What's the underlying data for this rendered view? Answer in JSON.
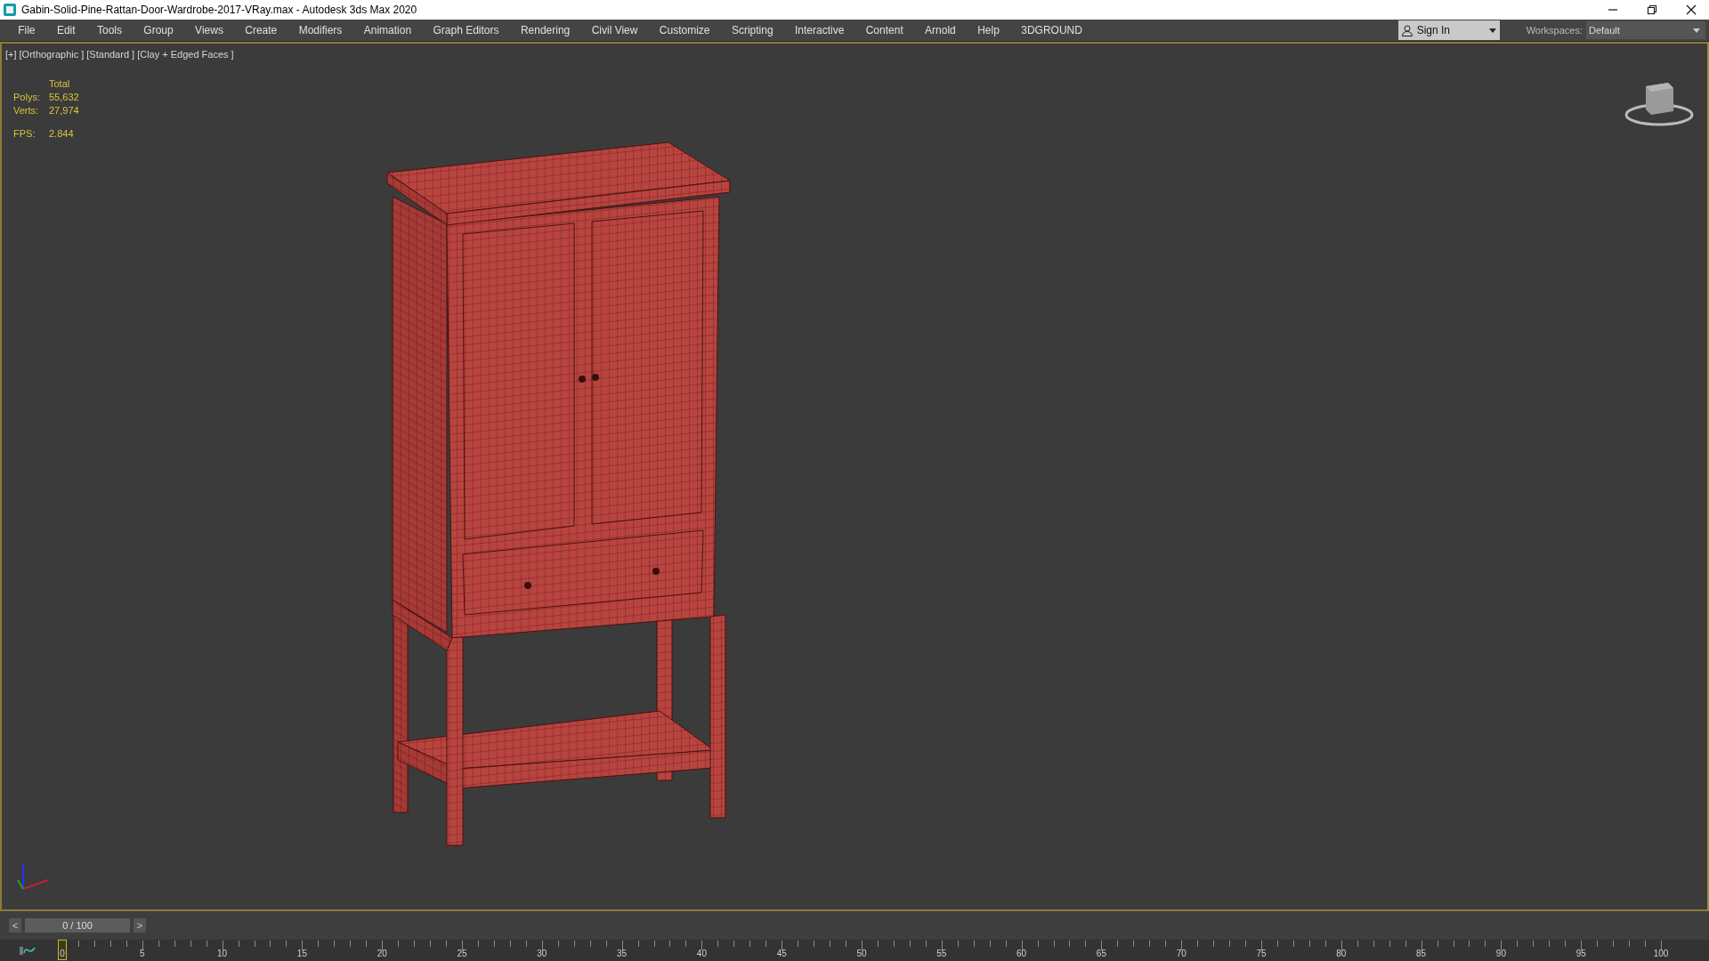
{
  "window": {
    "title": "Gabin-Solid-Pine-Rattan-Door-Wardrobe-2017-VRay.max - Autodesk 3ds Max 2020"
  },
  "menu_bar": {
    "items": [
      "File",
      "Edit",
      "Tools",
      "Group",
      "Views",
      "Create",
      "Modifiers",
      "Animation",
      "Graph Editors",
      "Rendering",
      "Civil View",
      "Customize",
      "Scripting",
      "Interactive",
      "Content",
      "Arnold",
      "Help",
      "3DGROUND"
    ]
  },
  "sign_in": {
    "label": "Sign In"
  },
  "workspaces": {
    "label": "Workspaces:",
    "value": "Default"
  },
  "viewport": {
    "labels": [
      "[+]",
      "[Orthographic ]",
      "[Standard ]",
      "[Clay + Edged Faces ]"
    ],
    "stats": {
      "header": "Total",
      "rows": [
        {
          "label": "Polys:",
          "value": "55,632"
        },
        {
          "label": "Verts:",
          "value": "27,974"
        }
      ],
      "fps": {
        "label": "FPS:",
        "value": "2.844"
      }
    }
  },
  "timeline": {
    "frame": "0 / 100",
    "prev": "<",
    "next": ">",
    "level": 0,
    "ticks": [
      "0",
      "5",
      "10",
      "15",
      "20",
      "25",
      "30",
      "35",
      "40",
      "45",
      "50",
      "55",
      "60",
      "65",
      "70",
      "75",
      "80",
      "85",
      "90",
      "95",
      "100"
    ]
  }
}
